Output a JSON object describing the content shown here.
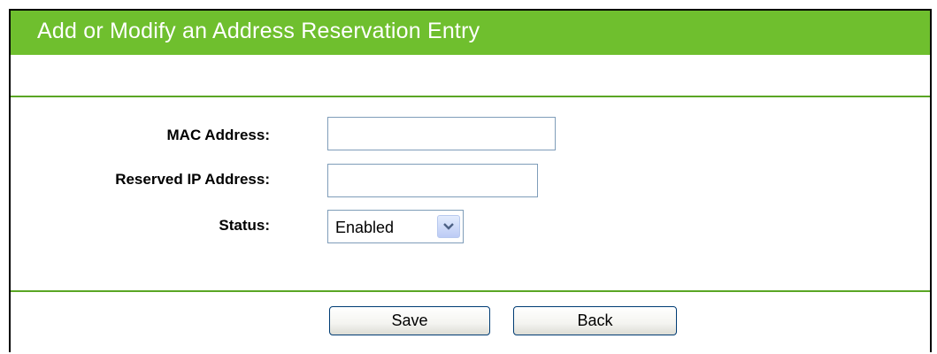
{
  "header": {
    "title": "Add or Modify an Address Reservation Entry"
  },
  "form": {
    "mac_label": "MAC Address:",
    "mac_value": "",
    "ip_label": "Reserved IP Address:",
    "ip_value": "",
    "status_label": "Status:",
    "status_selected": "Enabled"
  },
  "buttons": {
    "save_label": "Save",
    "back_label": "Back"
  },
  "colors": {
    "title_bar": "#6fbf2e",
    "rule": "#5aa624"
  },
  "icons": {
    "dropdown": "chevron-down-icon"
  }
}
